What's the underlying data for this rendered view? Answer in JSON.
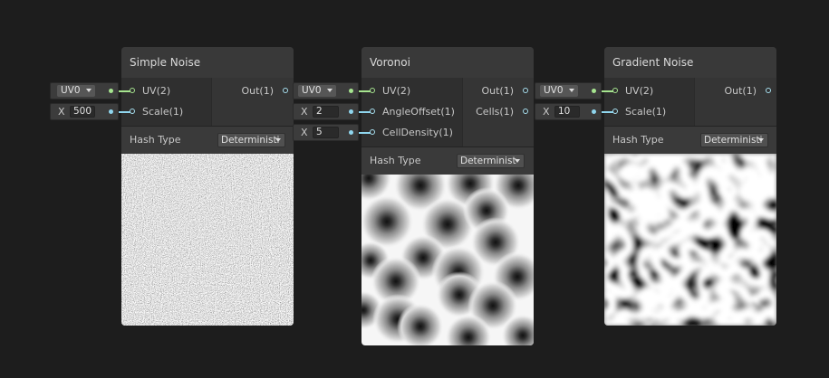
{
  "colors": {
    "canvas": "#1d1d1d",
    "node_body": "#2f2f2f",
    "node_title": "#393939",
    "port_vector2": "#a6e58f",
    "port_float": "#8fd6ee"
  },
  "nodes": [
    {
      "title": "Simple Noise",
      "inputs": [
        {
          "label": "UV(2)",
          "inline": "UV0"
        },
        {
          "label": "Scale(1)",
          "axis": "X",
          "inline": "500"
        }
      ],
      "outputs": [
        {
          "label": "Out(1)"
        }
      ],
      "hash_label": "Hash Type",
      "hash_value": "Deterministi",
      "preview": "simple-noise"
    },
    {
      "title": "Voronoi",
      "inputs": [
        {
          "label": "UV(2)",
          "inline": "UV0"
        },
        {
          "label": "AngleOffset(1)",
          "axis": "X",
          "inline": "2"
        },
        {
          "label": "CellDensity(1)",
          "axis": "X",
          "inline": "5"
        }
      ],
      "outputs": [
        {
          "label": "Out(1)"
        },
        {
          "label": "Cells(1)"
        }
      ],
      "hash_label": "Hash Type",
      "hash_value": "Determinist",
      "preview": "voronoi"
    },
    {
      "title": "Gradient Noise",
      "inputs": [
        {
          "label": "UV(2)",
          "inline": "UV0"
        },
        {
          "label": "Scale(1)",
          "axis": "X",
          "inline": "10"
        }
      ],
      "outputs": [
        {
          "label": "Out(1)"
        }
      ],
      "hash_label": "Hash Type",
      "hash_value": "Deterministi",
      "preview": "gradient-noise"
    }
  ]
}
